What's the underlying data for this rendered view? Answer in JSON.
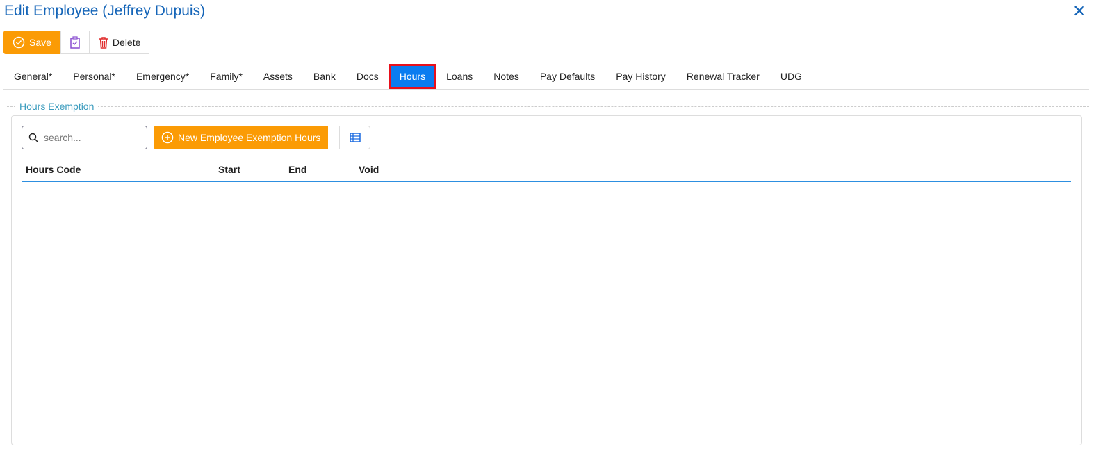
{
  "title": "Edit Employee (Jeffrey Dupuis)",
  "toolbar": {
    "save": "Save",
    "delete": "Delete"
  },
  "tabs": [
    "General*",
    "Personal*",
    "Emergency*",
    "Family*",
    "Assets",
    "Bank",
    "Docs",
    "Hours",
    "Loans",
    "Notes",
    "Pay Defaults",
    "Pay History",
    "Renewal Tracker",
    "UDG"
  ],
  "active_tab": "Hours",
  "section": {
    "legend": "Hours Exemption",
    "search_placeholder": "search...",
    "new_button": "New Employee Exemption Hours",
    "columns": [
      "Hours Code",
      "Start",
      "End",
      "Void"
    ]
  }
}
